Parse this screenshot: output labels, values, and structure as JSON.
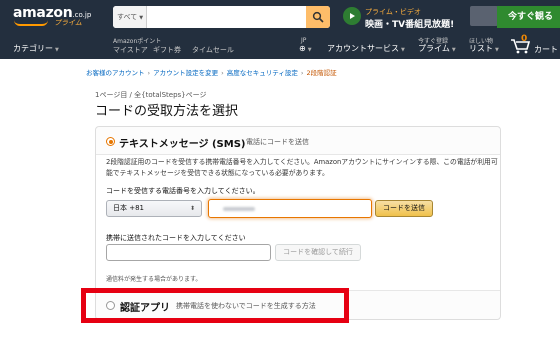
{
  "header": {
    "logo_text": "amazon",
    "logo_tld": ".co.jp",
    "logo_sub": "プライム",
    "search": {
      "category": "すべて",
      "placeholder": ""
    },
    "promo": {
      "line1": "プライム・ビデオ",
      "line2": "映画・TV番組見放題!"
    },
    "trial_button": "今すぐ観る",
    "nav": {
      "categories": "カテゴリー",
      "amazon_you_small": "Amazonポイント",
      "my_store": "マイストア",
      "gift_cards": "ギフト券",
      "timesale": "タイムセール",
      "lang_small": "JP",
      "account_services": "アカウントサービス",
      "prime_small": "今すぐ登録",
      "prime": "プライム",
      "list_small": "ほしい物",
      "list": "リスト",
      "cart": "カート",
      "cart_count": "0"
    }
  },
  "breadcrumb": {
    "items": [
      "お客様のアカウント",
      "アカウント設定を変更",
      "高度なセキュリティ設定"
    ],
    "current": "2段階認証"
  },
  "step_label": "1ページ目 / 全{totalSteps}ページ",
  "page_title": "コードの受取方法を選択",
  "sms": {
    "title": "テキストメッセージ (SMS)",
    "note": "電話にコードを送信",
    "description": "2段階認証用のコードを受信する携帯電話番号を入力してください。Amazonアカウントにサインインする際、この電話が利用可能でテキストメッセージを受信できる状態になっている必要があります。",
    "phone_label": "コードを受信する電話番号を入力してください。",
    "country": "日本 +81",
    "send_button": "コードを送信",
    "code_label": "携帯に送信されたコードを入力してください",
    "verify_button": "コードを確認して続行",
    "fee_note": "通信料が発生する場合があります。"
  },
  "app": {
    "title": "認証アプリ",
    "note": "携帯電話を使わないでコードを生成する方法"
  },
  "colors": {
    "nav_bg": "#232f3e",
    "accent_orange": "#e77600",
    "highlight_red": "#e60012",
    "button_yellow": "#f0c14b",
    "trial_green": "#2f8a2f"
  }
}
